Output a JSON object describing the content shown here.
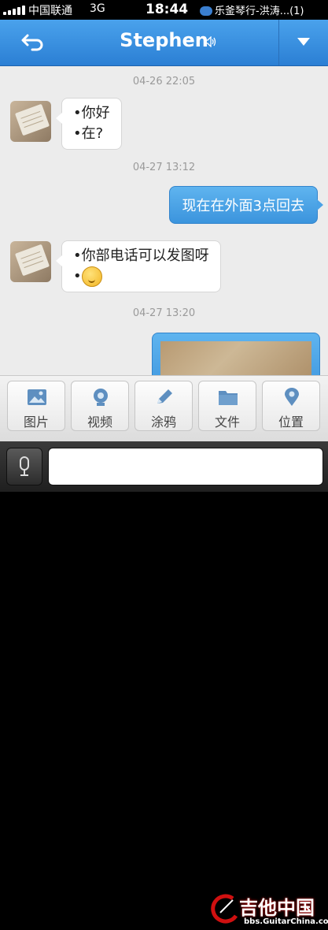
{
  "status_bar": {
    "carrier": "中国联通",
    "network": "3G",
    "time": "18:44",
    "notification": "乐釜琴行-洪涛...(1)"
  },
  "nav": {
    "title": "Stephen",
    "back_icon": "back-arrow-icon",
    "speaker_icon": "speaker-icon",
    "menu_icon": "dropdown-triangle-icon"
  },
  "chat": {
    "timestamps": [
      "04-26 22:05",
      "04-27 13:12",
      "04-27 13:20"
    ],
    "messages": [
      {
        "side": "left",
        "lines": [
          "•你好",
          "•在?"
        ]
      },
      {
        "side": "right",
        "text": "现在在外面3点回去"
      },
      {
        "side": "left",
        "lines": [
          "•你部电话可以发图呀",
          "•"
        ],
        "emoji": "smiley-face"
      },
      {
        "side": "right",
        "type": "image"
      }
    ]
  },
  "toolbar": {
    "items": [
      {
        "label": "图片",
        "icon": "picture-icon"
      },
      {
        "label": "视频",
        "icon": "video-icon"
      },
      {
        "label": "涂鸦",
        "icon": "pencil-icon"
      },
      {
        "label": "文件",
        "icon": "folder-icon"
      },
      {
        "label": "位置",
        "icon": "location-pin-icon"
      }
    ]
  },
  "input_bar": {
    "mic_icon": "microphone-icon",
    "placeholder": ""
  },
  "watermark": {
    "title": "吉他中国",
    "url": "bbs.GuitarChina.com"
  }
}
